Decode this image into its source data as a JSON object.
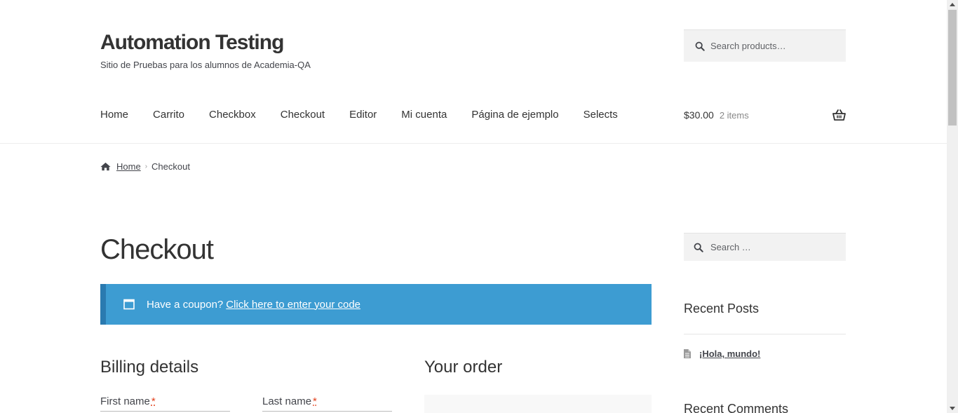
{
  "site": {
    "title": "Automation Testing",
    "description": "Sitio de Pruebas para los alumnos de Academia-QA"
  },
  "header_search": {
    "placeholder": "Search products…",
    "icon": "search-icon"
  },
  "nav": {
    "items": [
      {
        "label": "Home"
      },
      {
        "label": "Carrito"
      },
      {
        "label": "Checkbox"
      },
      {
        "label": "Checkout"
      },
      {
        "label": "Editor"
      },
      {
        "label": "Mi cuenta"
      },
      {
        "label": "Página de ejemplo"
      },
      {
        "label": "Selects"
      }
    ]
  },
  "cart": {
    "amount": "$30.00",
    "count": "2 items",
    "icon": "basket-icon"
  },
  "breadcrumb": {
    "home": "Home",
    "current": "Checkout",
    "separator": "›"
  },
  "page": {
    "title": "Checkout"
  },
  "coupon": {
    "text": "Have a coupon?",
    "link": "Click here to enter your code",
    "background": "#3d9cd2"
  },
  "billing": {
    "heading": "Billing details",
    "first_name_label": "First name",
    "last_name_label": "Last name",
    "required_mark": "*"
  },
  "order": {
    "heading": "Your order"
  },
  "sidebar": {
    "search_placeholder": "Search …",
    "recent_posts_title": "Recent Posts",
    "recent_posts": [
      {
        "title": "¡Hola, mundo!"
      }
    ],
    "recent_comments_title": "Recent Comments"
  }
}
